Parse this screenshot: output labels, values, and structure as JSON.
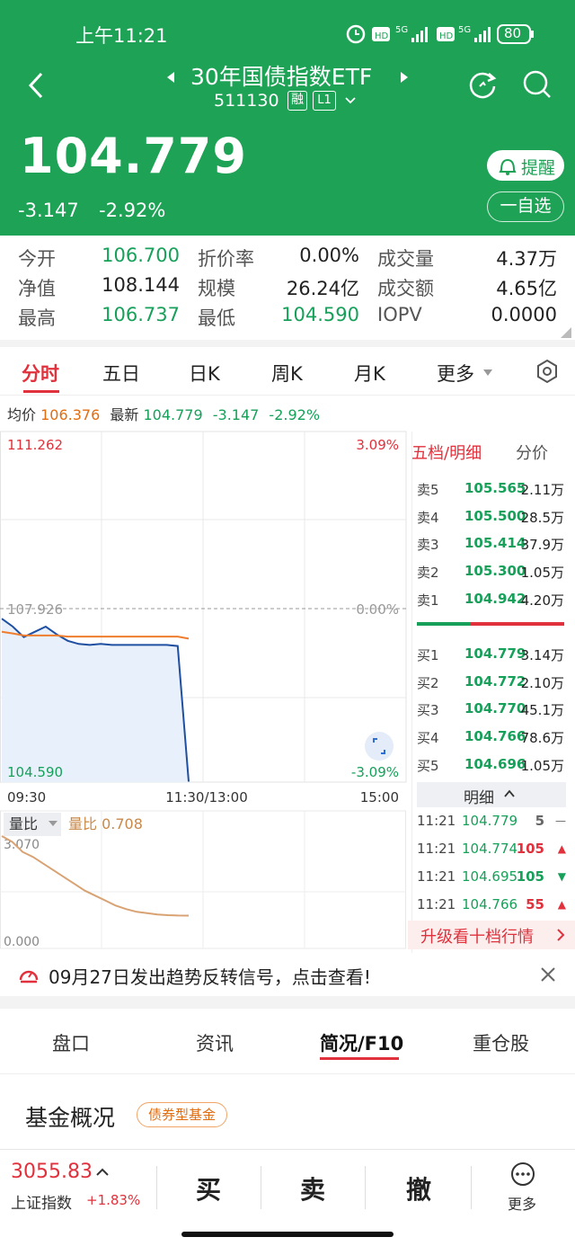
{
  "status": {
    "time": "上午11:21",
    "net1": "5G",
    "net2": "5G",
    "hd": "HD",
    "battery": "80"
  },
  "header": {
    "title": "30年国债指数ETF",
    "code": "511130",
    "badge1": "融",
    "badge2": "L1",
    "price": "104.779",
    "change": "-3.147",
    "change_pct": "-2.92%",
    "remind_label": "提醒",
    "watch_label": "一自选"
  },
  "quote": {
    "rows": [
      [
        {
          "l": "今开",
          "v": "106.700",
          "c": "green"
        },
        {
          "l": "折价率",
          "v": "0.00%",
          "c": "dark"
        },
        {
          "l": "成交量",
          "v": "4.37万",
          "c": "dark"
        }
      ],
      [
        {
          "l": "净值",
          "v": "108.144",
          "c": "dark"
        },
        {
          "l": "规模",
          "v": "26.24亿",
          "c": "dark"
        },
        {
          "l": "成交额",
          "v": "4.65亿",
          "c": "dark"
        }
      ],
      [
        {
          "l": "最高",
          "v": "106.737",
          "c": "green"
        },
        {
          "l": "最低",
          "v": "104.590",
          "c": "green"
        },
        {
          "l": "IOPV",
          "v": "0.0000",
          "c": "dark"
        }
      ]
    ]
  },
  "chart_tabs": [
    "分时",
    "五日",
    "日K",
    "周K",
    "月K",
    "更多"
  ],
  "avg_bar": {
    "avg_label": "均价",
    "avg": "106.376",
    "latest_label": "最新",
    "latest": "104.779",
    "chg": "-3.147",
    "pct": "-2.92%"
  },
  "chart_data": {
    "type": "line",
    "x_labels": [
      "09:30",
      "11:30/13:00",
      "15:00"
    ],
    "y_labels_left": [
      "111.262",
      "107.926",
      "104.590"
    ],
    "y_labels_right": [
      "3.09%",
      "0.00%",
      "-3.09%"
    ],
    "ylim": [
      104.59,
      111.262
    ],
    "series": [
      {
        "name": "最新",
        "color": "#1f4fa0",
        "values": [
          107.7,
          107.55,
          107.35,
          107.45,
          107.55,
          107.4,
          107.28,
          107.22,
          107.2,
          107.22,
          107.2,
          107.2,
          107.2,
          107.2,
          107.2,
          107.2,
          107.18,
          104.6
        ]
      },
      {
        "name": "均价",
        "color": "#ef7d2e",
        "values": [
          107.45,
          107.42,
          107.38,
          107.38,
          107.38,
          107.38,
          107.36,
          107.36,
          107.36,
          107.36,
          107.36,
          107.36,
          107.36,
          107.36,
          107.36,
          107.36,
          107.36,
          107.32
        ]
      }
    ],
    "volume_ratio": {
      "label": "量比",
      "value": "0.708",
      "ymax": "3.070",
      "ymin": "0.000",
      "values": [
        3.07,
        2.9,
        2.6,
        2.45,
        2.25,
        2.05,
        1.85,
        1.65,
        1.45,
        1.3,
        1.15,
        1.0,
        0.9,
        0.82,
        0.78,
        0.74,
        0.72,
        0.71,
        0.708
      ]
    }
  },
  "orderbook": {
    "title": "五档/明细",
    "alt": "分价",
    "sells": [
      {
        "n": "卖5",
        "p": "105.565",
        "q": "2.11万"
      },
      {
        "n": "卖4",
        "p": "105.500",
        "q": "28.5万"
      },
      {
        "n": "卖3",
        "p": "105.414",
        "q": "37.9万"
      },
      {
        "n": "卖2",
        "p": "105.300",
        "q": "1.05万"
      },
      {
        "n": "卖1",
        "p": "104.942",
        "q": "4.20万"
      }
    ],
    "buys": [
      {
        "n": "买1",
        "p": "104.779",
        "q": "3.14万"
      },
      {
        "n": "买2",
        "p": "104.772",
        "q": "2.10万"
      },
      {
        "n": "买3",
        "p": "104.770",
        "q": "45.1万"
      },
      {
        "n": "买4",
        "p": "104.766",
        "q": "78.6万"
      },
      {
        "n": "买5",
        "p": "104.696",
        "q": "1.05万"
      }
    ],
    "detail_label": "明细",
    "ticks": [
      {
        "t": "11:21",
        "p": "104.779",
        "v": "5",
        "dir": "flat"
      },
      {
        "t": "11:21",
        "p": "104.774",
        "v": "105",
        "dir": "up"
      },
      {
        "t": "11:21",
        "p": "104.695",
        "v": "105",
        "dir": "down"
      },
      {
        "t": "11:21",
        "p": "104.766",
        "v": "55",
        "dir": "up"
      }
    ],
    "upgrade_label": "升级看十档行情"
  },
  "notice": {
    "text": "09月27日发出趋势反转信号，点击查看!"
  },
  "bottom_tabs": [
    "盘口",
    "资讯",
    "简况/F10",
    "重仓股"
  ],
  "fund": {
    "title": "基金概况",
    "tag": "债券型基金"
  },
  "footer": {
    "index_value": "3055.83",
    "index_name": "上证指数",
    "index_pct": "+1.83%",
    "buy": "买",
    "sell": "卖",
    "cancel": "撤",
    "more": "更多"
  }
}
